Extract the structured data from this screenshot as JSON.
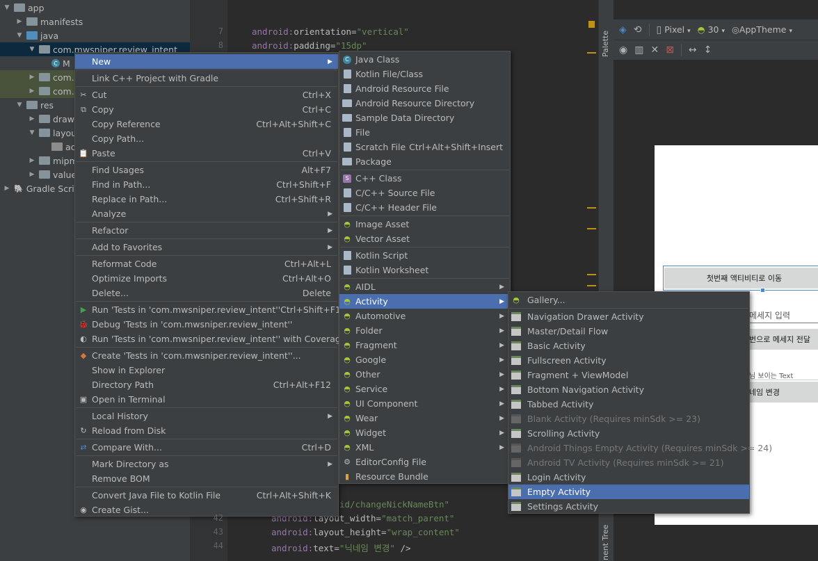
{
  "project_tree": {
    "items": [
      {
        "label": "app",
        "indent": 0,
        "arrow": "▼",
        "icon": "folder"
      },
      {
        "label": "manifests",
        "indent": 1,
        "arrow": "▶",
        "icon": "folder"
      },
      {
        "label": "java",
        "indent": 1,
        "arrow": "▼",
        "icon": "jfolder"
      },
      {
        "label": "com.mwsniper.review_intent",
        "indent": 2,
        "arrow": "▼",
        "icon": "folder"
      },
      {
        "label": "M",
        "indent": 3,
        "arrow": "",
        "icon": "class"
      },
      {
        "label": "com.",
        "indent": 2,
        "arrow": "▶",
        "icon": "folder"
      },
      {
        "label": "com.",
        "indent": 2,
        "arrow": "▶",
        "icon": "folder"
      },
      {
        "label": "res",
        "indent": 1,
        "arrow": "▼",
        "icon": "folder"
      },
      {
        "label": "drawa",
        "indent": 2,
        "arrow": "▶",
        "icon": "folder"
      },
      {
        "label": "layou",
        "indent": 2,
        "arrow": "▼",
        "icon": "folder"
      },
      {
        "label": "ac",
        "indent": 3,
        "arrow": "",
        "icon": "layout"
      },
      {
        "label": "mipm",
        "indent": 2,
        "arrow": "▶",
        "icon": "folder"
      },
      {
        "label": "value",
        "indent": 2,
        "arrow": "▶",
        "icon": "folder"
      },
      {
        "label": "Gradle Scrip",
        "indent": 0,
        "arrow": "▶",
        "icon": "gradle"
      }
    ]
  },
  "editor": {
    "lines_top": [
      {
        "num": "7",
        "parts": [
          {
            "t": "android:",
            "c": "ns"
          },
          {
            "t": "orientation=",
            "c": "attr"
          },
          {
            "t": "\"vertical\"",
            "c": "val"
          }
        ]
      },
      {
        "num": "8",
        "parts": [
          {
            "t": "android:",
            "c": "ns"
          },
          {
            "t": "padding=",
            "c": "attr"
          },
          {
            "t": "\"15dp\"",
            "c": "val"
          }
        ]
      }
    ],
    "lines_bottom": [
      {
        "num": "",
        "parts": [
          {
            "t": "id/changeNickNameBtn\"",
            "c": "val"
          }
        ]
      },
      {
        "num": "42",
        "parts": [
          {
            "t": "android:",
            "c": "ns"
          },
          {
            "t": "layout_width=",
            "c": "attr"
          },
          {
            "t": "\"match_parent\"",
            "c": "val"
          }
        ]
      },
      {
        "num": "43",
        "parts": [
          {
            "t": "android:",
            "c": "ns"
          },
          {
            "t": "layout_height=",
            "c": "attr"
          },
          {
            "t": "\"wrap_content\"",
            "c": "val"
          }
        ]
      },
      {
        "num": "44",
        "parts": [
          {
            "t": "android:",
            "c": "ns"
          },
          {
            "t": "text=",
            "c": "attr"
          },
          {
            "t": "\"닉네임 변경\"",
            "c": "val"
          },
          {
            "t": " />",
            "c": "attr"
          }
        ]
      }
    ]
  },
  "palette_tab": "Palette",
  "component_tree_tab": "nent Tree",
  "design_toolbar": {
    "device": "Pixel",
    "api": "30",
    "theme": "AppTheme"
  },
  "preview": {
    "button1": "첫번째 액티비티로 이동",
    "hint_input": "메세지 입력",
    "button2": "번으로 메세지 전달",
    "text_view": "님 보이는 Text",
    "button3": "네임 변경"
  },
  "context_menu": {
    "items": [
      {
        "label": "New",
        "shortcut": "",
        "icon": "",
        "submenu": true,
        "selected": true
      },
      {
        "sep": true
      },
      {
        "label": "Link C++ Project with Gradle",
        "shortcut": "",
        "icon": ""
      },
      {
        "sep": true
      },
      {
        "label": "Cut",
        "shortcut": "Ctrl+X",
        "icon": "✂"
      },
      {
        "label": "Copy",
        "shortcut": "Ctrl+C",
        "icon": "⧉"
      },
      {
        "label": "Copy Reference",
        "shortcut": "Ctrl+Alt+Shift+C",
        "icon": ""
      },
      {
        "label": "Copy Path...",
        "shortcut": "",
        "icon": ""
      },
      {
        "label": "Paste",
        "shortcut": "Ctrl+V",
        "icon": "📋"
      },
      {
        "sep": true
      },
      {
        "label": "Find Usages",
        "shortcut": "Alt+F7",
        "icon": ""
      },
      {
        "label": "Find in Path...",
        "shortcut": "Ctrl+Shift+F",
        "icon": ""
      },
      {
        "label": "Replace in Path...",
        "shortcut": "Ctrl+Shift+R",
        "icon": ""
      },
      {
        "label": "Analyze",
        "shortcut": "",
        "icon": "",
        "submenu": true
      },
      {
        "sep": true
      },
      {
        "label": "Refactor",
        "shortcut": "",
        "icon": "",
        "submenu": true
      },
      {
        "sep": true
      },
      {
        "label": "Add to Favorites",
        "shortcut": "",
        "icon": "",
        "submenu": true
      },
      {
        "sep": true
      },
      {
        "label": "Reformat Code",
        "shortcut": "Ctrl+Alt+L",
        "icon": ""
      },
      {
        "label": "Optimize Imports",
        "shortcut": "Ctrl+Alt+O",
        "icon": ""
      },
      {
        "label": "Delete...",
        "shortcut": "Delete",
        "icon": ""
      },
      {
        "sep": true
      },
      {
        "label": "Run 'Tests in 'com.mwsniper.review_intent''",
        "shortcut": "Ctrl+Shift+F10",
        "icon": "▶"
      },
      {
        "label": "Debug 'Tests in 'com.mwsniper.review_intent''",
        "shortcut": "",
        "icon": "🐞"
      },
      {
        "label": "Run 'Tests in 'com.mwsniper.review_intent'' with Coverage",
        "shortcut": "",
        "icon": "◐"
      },
      {
        "sep": true
      },
      {
        "label": "Create 'Tests in 'com.mwsniper.review_intent''...",
        "shortcut": "",
        "icon": "◆"
      },
      {
        "label": "Show in Explorer",
        "shortcut": "",
        "icon": ""
      },
      {
        "label": "Directory Path",
        "shortcut": "Ctrl+Alt+F12",
        "icon": ""
      },
      {
        "label": "Open in Terminal",
        "shortcut": "",
        "icon": "▣"
      },
      {
        "sep": true
      },
      {
        "label": "Local History",
        "shortcut": "",
        "icon": "",
        "submenu": true
      },
      {
        "label": "Reload from Disk",
        "shortcut": "",
        "icon": "↻"
      },
      {
        "sep": true
      },
      {
        "label": "Compare With...",
        "shortcut": "Ctrl+D",
        "icon": "⇄"
      },
      {
        "sep": true
      },
      {
        "label": "Mark Directory as",
        "shortcut": "",
        "icon": "",
        "submenu": true
      },
      {
        "label": "Remove BOM",
        "shortcut": "",
        "icon": ""
      },
      {
        "sep": true
      },
      {
        "label": "Convert Java File to Kotlin File",
        "shortcut": "Ctrl+Alt+Shift+K",
        "icon": ""
      },
      {
        "label": "Create Gist...",
        "shortcut": "",
        "icon": "◉"
      }
    ]
  },
  "new_menu": {
    "items": [
      {
        "label": "Java Class",
        "shortcut": "",
        "icon": "java"
      },
      {
        "label": "Kotlin File/Class",
        "shortcut": "",
        "icon": "file"
      },
      {
        "label": "Android Resource File",
        "shortcut": "",
        "icon": "file"
      },
      {
        "label": "Android Resource Directory",
        "shortcut": "",
        "icon": "folder"
      },
      {
        "label": "Sample Data Directory",
        "shortcut": "",
        "icon": "folder"
      },
      {
        "label": "File",
        "shortcut": "",
        "icon": "file"
      },
      {
        "label": "Scratch File",
        "shortcut": "Ctrl+Alt+Shift+Insert",
        "icon": "file"
      },
      {
        "label": "Package",
        "shortcut": "",
        "icon": "folder"
      },
      {
        "sep": true
      },
      {
        "label": "C++ Class",
        "shortcut": "",
        "icon": "cpp"
      },
      {
        "label": "C/C++ Source File",
        "shortcut": "",
        "icon": "file"
      },
      {
        "label": "C/C++ Header File",
        "shortcut": "",
        "icon": "file"
      },
      {
        "sep": true
      },
      {
        "label": "Image Asset",
        "shortcut": "",
        "icon": "android"
      },
      {
        "label": "Vector Asset",
        "shortcut": "",
        "icon": "android"
      },
      {
        "sep": true
      },
      {
        "label": "Kotlin Script",
        "shortcut": "",
        "icon": "file"
      },
      {
        "label": "Kotlin Worksheet",
        "shortcut": "",
        "icon": "file"
      },
      {
        "sep": true
      },
      {
        "label": "AIDL",
        "shortcut": "",
        "icon": "android",
        "submenu": true
      },
      {
        "label": "Activity",
        "shortcut": "",
        "icon": "android",
        "submenu": true,
        "selected": true
      },
      {
        "label": "Automotive",
        "shortcut": "",
        "icon": "android",
        "submenu": true
      },
      {
        "label": "Folder",
        "shortcut": "",
        "icon": "android",
        "submenu": true
      },
      {
        "label": "Fragment",
        "shortcut": "",
        "icon": "android",
        "submenu": true
      },
      {
        "label": "Google",
        "shortcut": "",
        "icon": "android",
        "submenu": true
      },
      {
        "label": "Other",
        "shortcut": "",
        "icon": "android",
        "submenu": true
      },
      {
        "label": "Service",
        "shortcut": "",
        "icon": "android",
        "submenu": true
      },
      {
        "label": "UI Component",
        "shortcut": "",
        "icon": "android",
        "submenu": true
      },
      {
        "label": "Wear",
        "shortcut": "",
        "icon": "android",
        "submenu": true
      },
      {
        "label": "Widget",
        "shortcut": "",
        "icon": "android",
        "submenu": true
      },
      {
        "label": "XML",
        "shortcut": "",
        "icon": "android",
        "submenu": true
      },
      {
        "label": "EditorConfig File",
        "shortcut": "",
        "icon": "gear"
      },
      {
        "label": "Resource Bundle",
        "shortcut": "",
        "icon": "bundle"
      }
    ]
  },
  "activity_menu": {
    "items": [
      {
        "label": "Gallery...",
        "icon": "android"
      },
      {
        "sep": true
      },
      {
        "label": "Navigation Drawer Activity",
        "icon": "act"
      },
      {
        "label": "Master/Detail Flow",
        "icon": "act"
      },
      {
        "label": "Basic Activity",
        "icon": "act"
      },
      {
        "label": "Fullscreen Activity",
        "icon": "act"
      },
      {
        "label": "Fragment + ViewModel",
        "icon": "act"
      },
      {
        "label": "Bottom Navigation Activity",
        "icon": "act"
      },
      {
        "label": "Tabbed Activity",
        "icon": "act"
      },
      {
        "label": "Blank Activity (Requires minSdk >= 23)",
        "icon": "act",
        "disabled": true
      },
      {
        "label": "Scrolling Activity",
        "icon": "act"
      },
      {
        "label": "Android Things Empty Activity (Requires minSdk >= 24)",
        "icon": "act",
        "disabled": true
      },
      {
        "label": "Android TV Activity (Requires minSdk >= 21)",
        "icon": "act",
        "disabled": true
      },
      {
        "label": "Login Activity",
        "icon": "act"
      },
      {
        "label": "Empty Activity",
        "icon": "act",
        "selected": true
      },
      {
        "label": "Settings Activity",
        "icon": "act"
      }
    ]
  }
}
